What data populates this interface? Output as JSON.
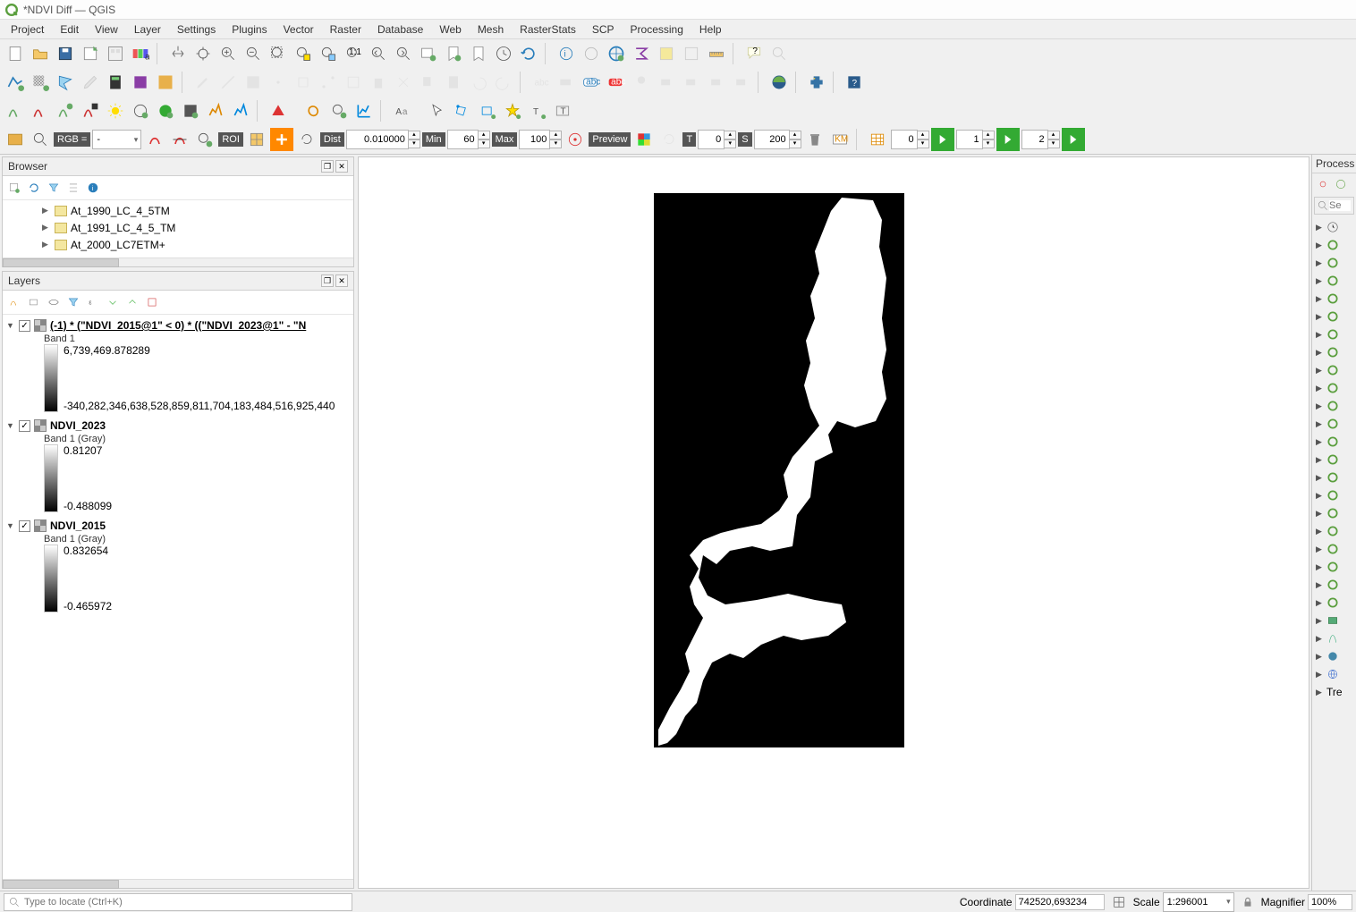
{
  "window": {
    "title": "*NDVI Diff — QGIS"
  },
  "menu": [
    "Project",
    "Edit",
    "View",
    "Layer",
    "Settings",
    "Plugins",
    "Vector",
    "Raster",
    "Database",
    "Web",
    "Mesh",
    "RasterStats",
    "SCP",
    "Processing",
    "Help"
  ],
  "scp_bar": {
    "rgb_label": "RGB =",
    "rgb_value": "-",
    "roi_label": "ROI",
    "dist_label": "Dist",
    "dist_value": "0.010000",
    "min_label": "Min",
    "min_value": "60",
    "max_label": "Max",
    "max_value": "100",
    "preview_label": "Preview",
    "t_label": "T",
    "t_value": "0",
    "s_label": "S",
    "s_value": "200",
    "n1_value": "0",
    "n2_value": "1",
    "n3_value": "2"
  },
  "browser": {
    "title": "Browser",
    "items": [
      "At_1990_LC_4_5TM",
      "At_1991_LC_4_5_TM",
      "At_2000_LC7ETM+"
    ]
  },
  "layers": {
    "title": "Layers",
    "items": [
      {
        "name": "(-1) * (\"NDVI_2015@1\" < 0) * ((\"NDVI_2023@1\" - \"N",
        "selected": true,
        "band": "Band 1",
        "max": "6,739,469.878289",
        "min": "-340,282,346,638,528,859,811,704,183,484,516,925,440"
      },
      {
        "name": "NDVI_2023",
        "selected": false,
        "band": "Band 1 (Gray)",
        "max": "0.81207",
        "min": "-0.488099"
      },
      {
        "name": "NDVI_2015",
        "selected": false,
        "band": "Band 1 (Gray)",
        "max": "0.832654",
        "min": "-0.465972"
      }
    ]
  },
  "processing": {
    "title": "Process",
    "search_placeholder": "Se",
    "last_item": "Tre"
  },
  "status": {
    "locator_placeholder": "Type to locate (Ctrl+K)",
    "coord_label": "Coordinate",
    "coord_value": "742520,693234",
    "scale_label": "Scale",
    "scale_value": "1:296001",
    "mag_label": "Magnifier",
    "mag_value": "100%"
  }
}
